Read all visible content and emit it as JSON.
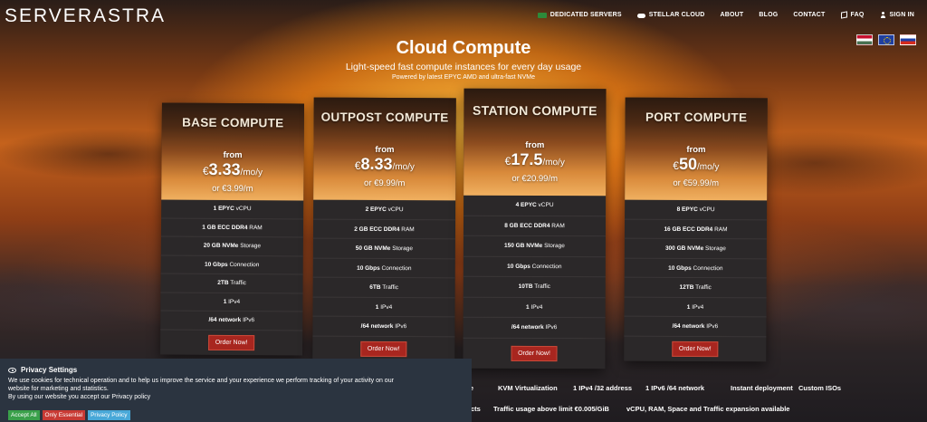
{
  "brand": {
    "logo": "SERVERASTRA"
  },
  "nav": {
    "items": [
      {
        "label": "DEDICATED SERVERS",
        "icon": "server-icon"
      },
      {
        "label": "STELLAR CLOUD",
        "icon": "cloud-icon"
      },
      {
        "label": "ABOUT"
      },
      {
        "label": "BLOG"
      },
      {
        "label": "CONTACT"
      },
      {
        "label": "FAQ",
        "icon": "book-icon"
      },
      {
        "label": "SIGN IN",
        "icon": "user-icon"
      }
    ]
  },
  "flags": [
    "hungarian-flag-icon",
    "eu-flag-icon",
    "russian-flag-icon"
  ],
  "hero": {
    "title": "Cloud Compute",
    "subtitle": "Light-speed fast compute instances for every day usage",
    "small": "Powered by latest EPYC AMD and ultra-fast NVMe"
  },
  "plans": [
    {
      "title": "BASE COMPUTE",
      "from": "from",
      "currency": "€",
      "price": "3.33",
      "per": "/mo/y",
      "alt": "or €3.99/m",
      "features": [
        [
          "1 EPYC",
          "vCPU"
        ],
        [
          "1 GB ECC DDR4",
          "RAM"
        ],
        [
          "20 GB NVMe",
          "Storage"
        ],
        [
          "10 Gbps",
          "Connection"
        ],
        [
          "2TB",
          "Traffic"
        ],
        [
          "1",
          "IPv4"
        ],
        [
          "/64 network",
          "IPv6"
        ]
      ],
      "order": "Order Now!"
    },
    {
      "title": "OUTPOST COMPUTE",
      "from": "from",
      "currency": "€",
      "price": "8.33",
      "per": "/mo/y",
      "alt": "or €9.99/m",
      "features": [
        [
          "2 EPYC",
          "vCPU"
        ],
        [
          "2 GB ECC DDR4",
          "RAM"
        ],
        [
          "50 GB NVMe",
          "Storage"
        ],
        [
          "10 Gbps",
          "Connection"
        ],
        [
          "6TB",
          "Traffic"
        ],
        [
          "1",
          "IPv4"
        ],
        [
          "/64 network",
          "IPv6"
        ]
      ],
      "order": "Order Now!"
    },
    {
      "title": "STATION COMPUTE",
      "from": "from",
      "currency": "€",
      "price": "17.5",
      "per": "/mo/y",
      "alt": "or €20.99/m",
      "features": [
        [
          "4 EPYC",
          "vCPU"
        ],
        [
          "8 GB ECC DDR4",
          "RAM"
        ],
        [
          "150 GB NVMe",
          "Storage"
        ],
        [
          "10 Gbps",
          "Connection"
        ],
        [
          "10TB",
          "Traffic"
        ],
        [
          "1",
          "IPv4"
        ],
        [
          "/64 network",
          "IPv6"
        ]
      ],
      "order": "Order Now!"
    },
    {
      "title": "PORT COMPUTE",
      "from": "from",
      "currency": "€",
      "price": "50",
      "per": "/mo/y",
      "alt": "or €59.99/m",
      "features": [
        [
          "8 EPYC",
          "vCPU"
        ],
        [
          "16 GB ECC DDR4",
          "RAM"
        ],
        [
          "300 GB NVMe",
          "Storage"
        ],
        [
          "10 Gbps",
          "Connection"
        ],
        [
          "12TB",
          "Traffic"
        ],
        [
          "1",
          "IPv4"
        ],
        [
          "/64 network",
          "IPv6"
        ]
      ],
      "order": "Order Now!"
    }
  ],
  "features_strip": {
    "row1": [
      "sole",
      "KVM Virtualization",
      "1 IPv4 /32 address",
      "1 IPv6 /64 network",
      "Instant deployment",
      "Custom ISOs"
    ],
    "row2": [
      "cts",
      "Traffic usage above limit €0.005/GiB",
      "vCPU, RAM, Space and Traffic expansion available"
    ]
  },
  "privacy": {
    "title": "Privacy Settings",
    "line1": "We use cookies for technical operation and to help us improve the service and your experience we perform tracking of your activity on our",
    "line2": "website for marketing and statistics.",
    "line3": "By using our website you accept our Privacy policy",
    "accept": "Accept All",
    "essential": "Only Essential",
    "policy": "Privacy Policy"
  }
}
